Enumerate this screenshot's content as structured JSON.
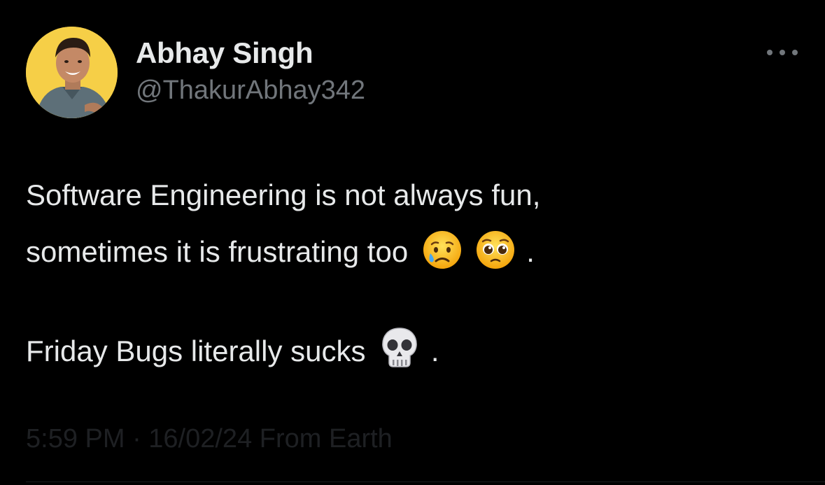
{
  "author": {
    "display_name": "Abhay Singh",
    "handle": "@ThakurAbhay342",
    "avatar_icon": "profile-photo"
  },
  "more_button": {
    "icon": "more-horizontal-icon",
    "color": "#71767b"
  },
  "tweet": {
    "line1": "Software Engineering is not always fun,",
    "line2_text": "sometimes it is frustrating too",
    "line2_emojis": [
      "crying-face-emoji",
      "pleading-face-emoji"
    ],
    "line2_end": ".",
    "line3_text": "Friday Bugs literally sucks",
    "line3_emojis": [
      "skull-emoji"
    ],
    "line3_end": "."
  },
  "meta": {
    "timestamp": "5:59 PM · 16/02/24 From Earth"
  },
  "colors": {
    "background": "#000000",
    "primary_text": "#e7e9ea",
    "secondary_text": "#71767b",
    "avatar_bg": "#f6cf47"
  }
}
